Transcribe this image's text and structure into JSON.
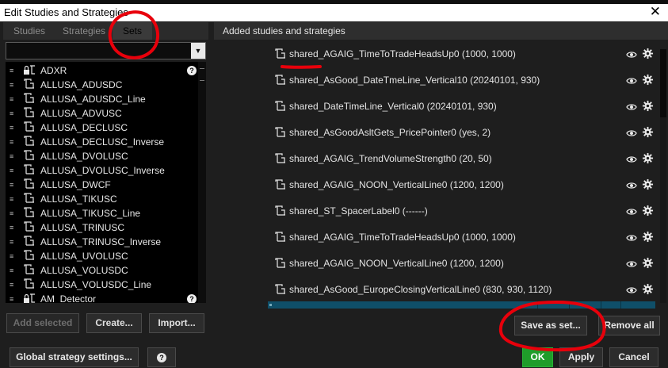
{
  "window": {
    "title": "Edit Studies and Strategies",
    "close_glyph": "✕"
  },
  "tabs": [
    {
      "label": "Studies",
      "active": false
    },
    {
      "label": "Strategies",
      "active": false
    },
    {
      "label": "Sets",
      "active": true
    }
  ],
  "search": {
    "value": "",
    "dropdown_glyph": "▼"
  },
  "study_list": [
    {
      "label": "ADXR",
      "icon": "lock-study-icon",
      "help": true
    },
    {
      "label": "ALLUSA_ADUSDC",
      "icon": "study-icon",
      "help": false
    },
    {
      "label": "ALLUSA_ADUSDC_Line",
      "icon": "study-icon",
      "help": false
    },
    {
      "label": "ALLUSA_ADVUSC",
      "icon": "study-icon",
      "help": false
    },
    {
      "label": "ALLUSA_DECLUSC",
      "icon": "study-icon",
      "help": false
    },
    {
      "label": "ALLUSA_DECLUSC_Inverse",
      "icon": "study-icon",
      "help": false
    },
    {
      "label": "ALLUSA_DVOLUSC",
      "icon": "study-icon",
      "help": false
    },
    {
      "label": "ALLUSA_DVOLUSC_Inverse",
      "icon": "study-icon",
      "help": false
    },
    {
      "label": "ALLUSA_DWCF",
      "icon": "study-icon",
      "help": false
    },
    {
      "label": "ALLUSA_TIKUSC",
      "icon": "study-icon",
      "help": false
    },
    {
      "label": "ALLUSA_TIKUSC_Line",
      "icon": "study-icon",
      "help": false
    },
    {
      "label": "ALLUSA_TRINUSC",
      "icon": "study-icon",
      "help": false
    },
    {
      "label": "ALLUSA_TRINUSC_Inverse",
      "icon": "study-icon",
      "help": false
    },
    {
      "label": "ALLUSA_UVOLUSC",
      "icon": "study-icon",
      "help": false
    },
    {
      "label": "ALLUSA_VOLUSDC",
      "icon": "study-icon",
      "help": false
    },
    {
      "label": "ALLUSA_VOLUSDC_Line",
      "icon": "study-icon",
      "help": false
    },
    {
      "label": "AM_Detector",
      "icon": "lock-study-icon",
      "help": true
    }
  ],
  "help_glyph": "?",
  "left_buttons": {
    "add_selected": "Add selected",
    "create": "Create...",
    "import": "Import..."
  },
  "added": {
    "header": "Added studies and strategies",
    "items": [
      "shared_AGAIG_TimeToTradeHeadsUp0 (1000, 1000)",
      "shared_AsGood_DateTmeLine_Vertical10 (20240101, 930)",
      "shared_DateTimeLine_Vertical0 (20240101, 930)",
      "shared_AsGoodAsltGets_PricePointer0 (yes, 2)",
      "shared_AGAIG_TrendVolumeStrength0 (20, 50)",
      "shared_AGAIG_NOON_VerticalLine0 (1200, 1200)",
      "shared_ST_SpacerLabel0 (------)",
      "shared_AGAIG_TimeToTradeHeadsUp0 (1000, 1000)",
      "shared_AGAIG_NOON_VerticalLine0 (1200, 1200)",
      "shared_AsGood_EuropeClosingVerticalLine0 (830, 930, 1120)"
    ]
  },
  "right_buttons": {
    "save_as_set": "Save as set...",
    "remove_all": "Remove all"
  },
  "bottom_buttons": {
    "global_settings": "Global strategy settings...",
    "help": "?",
    "ok": "OK",
    "apply": "Apply",
    "cancel": "Cancel"
  },
  "colors": {
    "ok_green": "#1f9d2a",
    "annotation_red": "#e8000b",
    "scroll_blue": "#0f4f69"
  }
}
